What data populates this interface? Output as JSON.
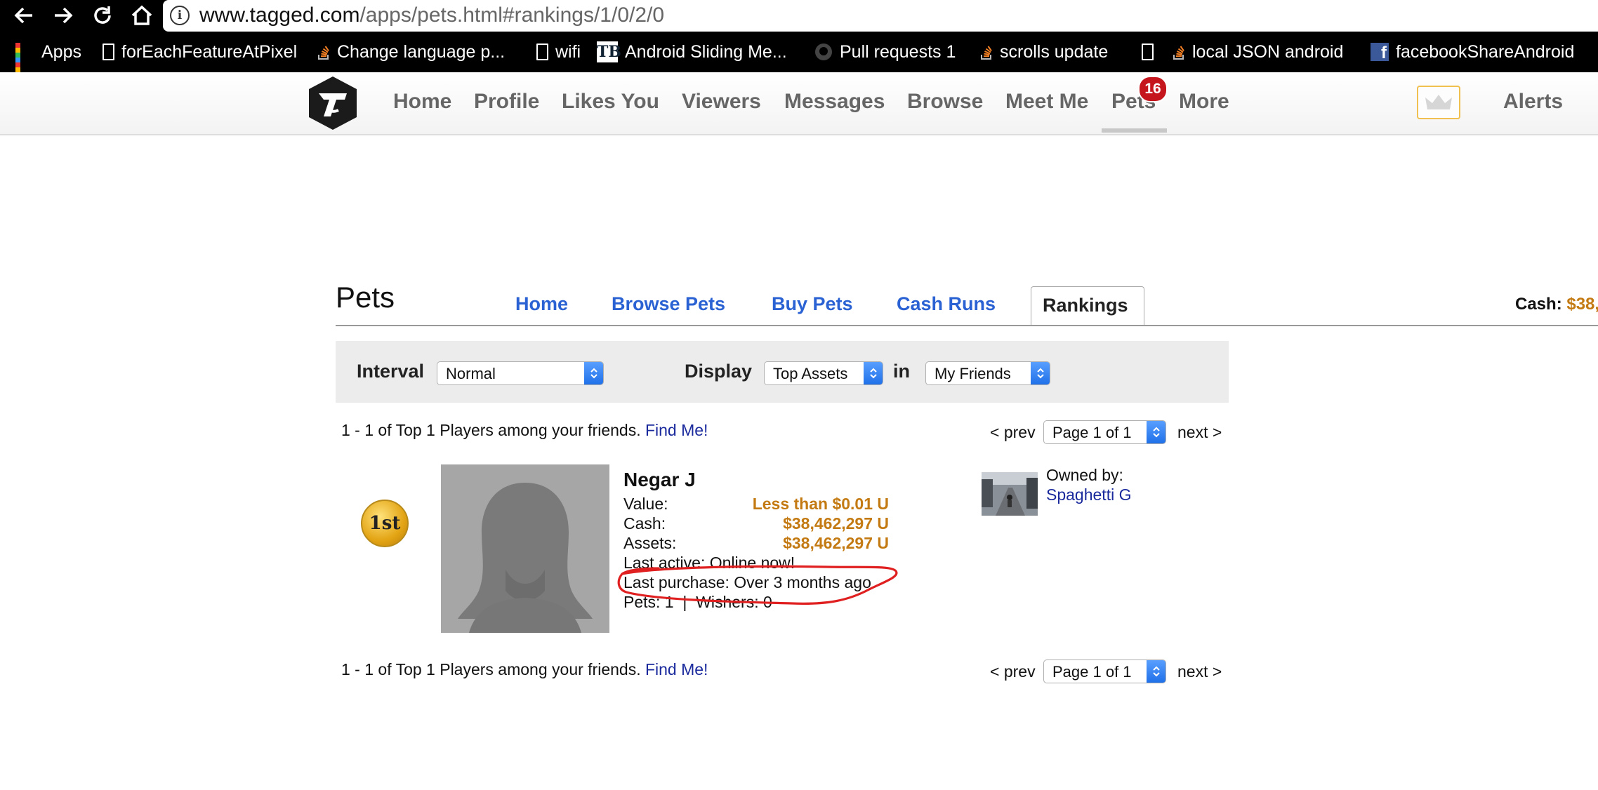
{
  "browser": {
    "url_host": "www.tagged.com",
    "url_path": "/apps/pets.html#rankings/1/0/2/0",
    "bookmarks": [
      {
        "label": "Apps",
        "icon": "apps-grid-icon"
      },
      {
        "label": "forEachFeatureAtPixel",
        "icon": "document-icon"
      },
      {
        "label": "Change language p...",
        "icon": "stackoverflow-icon"
      },
      {
        "label": "wifi",
        "icon": "document-icon"
      },
      {
        "label": "Android Sliding Me...",
        "icon": "tb-icon"
      },
      {
        "label": "Pull requests 1",
        "icon": "github-icon"
      },
      {
        "label": "scrolls update",
        "icon": "stackoverflow-icon"
      },
      {
        "label": "",
        "icon": "document-icon"
      },
      {
        "label": "local JSON android",
        "icon": "stackoverflow-icon"
      },
      {
        "label": "facebookShareAndroid",
        "icon": "facebook-icon"
      }
    ]
  },
  "site_nav": {
    "items": [
      "Home",
      "Profile",
      "Likes You",
      "Viewers",
      "Messages",
      "Browse",
      "Meet Me",
      "Pets",
      "More"
    ],
    "pets_badge": "16",
    "alerts": "Alerts"
  },
  "pets": {
    "title": "Pets",
    "tabs": [
      "Home",
      "Browse Pets",
      "Buy Pets",
      "Cash Runs",
      "Rankings"
    ],
    "active_tab": "Rankings",
    "cash_label": "Cash:",
    "cash_value": "$38,"
  },
  "filters": {
    "interval_label": "Interval",
    "interval_value": "Normal",
    "display_label": "Display",
    "display_value": "Top Assets",
    "in_label": "in",
    "scope_value": "My Friends"
  },
  "results": {
    "summary": "1 - 1 of Top 1 Players among your friends.",
    "find_me": "Find Me!",
    "prev": "< prev",
    "page": "Page 1 of 1",
    "next": "next >"
  },
  "player": {
    "rank": "1st",
    "name": "Negar J",
    "value_label": "Value:",
    "value": "Less than $0.01 U",
    "cash_label": "Cash:",
    "cash": "$38,462,297 U",
    "assets_label": "Assets:",
    "assets": "$38,462,297 U",
    "last_active": "Last active: Online now!",
    "last_purchase": "Last purchase: Over 3 months ago",
    "pets_wishers": "Pets: 1  |  Wishers: 0",
    "owned_by_label": "Owned by:",
    "owner": "Spaghetti G"
  },
  "colors": {
    "link_blue": "#2a62d3",
    "money_orange": "#c47a12",
    "badge_red": "#c5161d",
    "annotation_red": "#e02020"
  }
}
